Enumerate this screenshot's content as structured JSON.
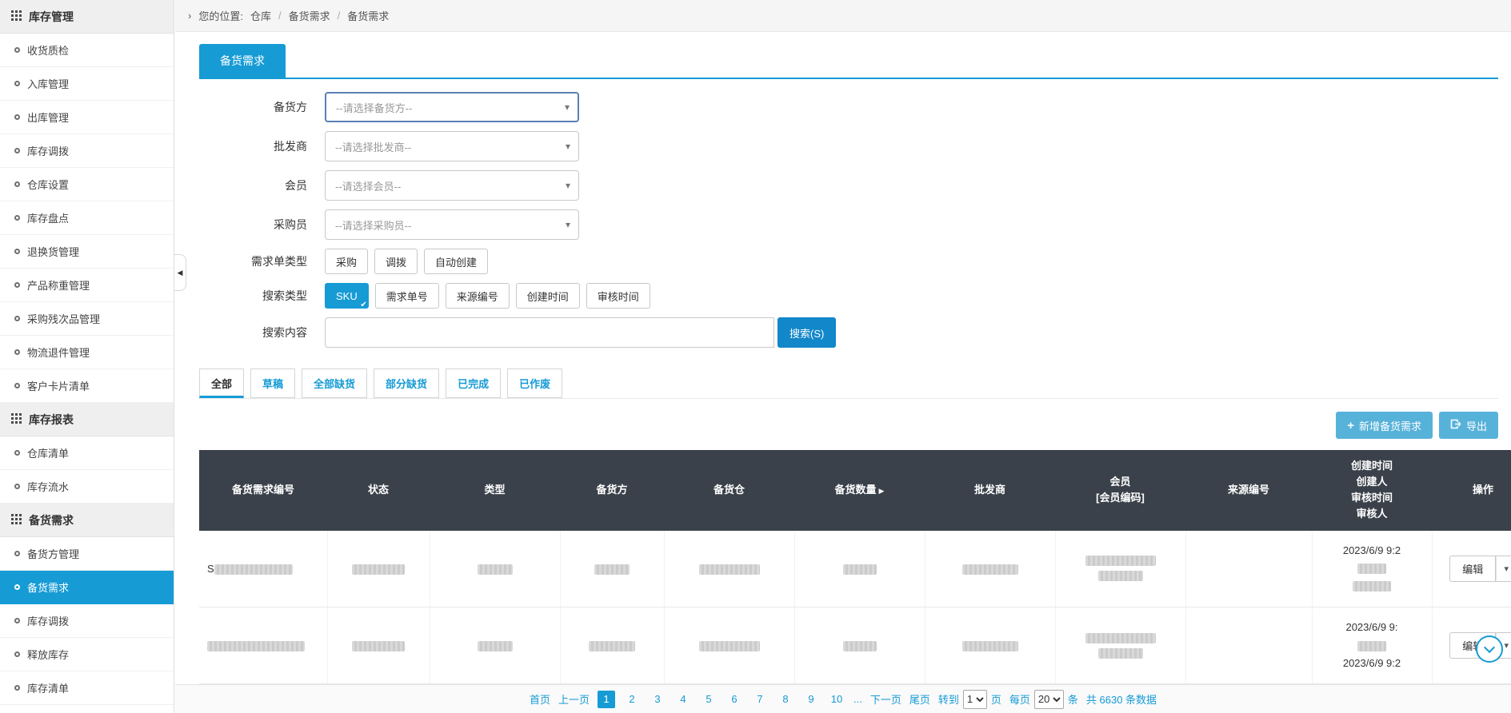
{
  "app": {
    "primary_color": "#169bd5",
    "table_header_color": "#3a414a"
  },
  "icons": {
    "breadcrumb_arrow": "›",
    "caret_down": "▾",
    "check": "✔",
    "sort_right": "▶",
    "collapse_left": "◀",
    "add": "+",
    "ellipsis": "..."
  },
  "sidebar": {
    "sections": [
      {
        "title": "库存管理",
        "items": [
          "收货质检",
          "入库管理",
          "出库管理",
          "库存调拨",
          "仓库设置",
          "库存盘点",
          "退换货管理",
          "产品称重管理",
          "采购残次品管理",
          "物流退件管理",
          "客户卡片清单"
        ]
      },
      {
        "title": "库存报表",
        "items": [
          "仓库清单",
          "库存流水"
        ]
      },
      {
        "title": "备货需求",
        "items": [
          "备货方管理",
          "备货需求",
          "库存调拨",
          "释放库存",
          "库存清单"
        ]
      }
    ],
    "active_item": "备货需求"
  },
  "breadcrumb": {
    "prefix": "您的位置:",
    "separator": "/",
    "items": [
      "仓库",
      "备货需求",
      "备货需求"
    ]
  },
  "page_tab": "备货需求",
  "filters": {
    "supplier": {
      "label": "备货方",
      "placeholder": "--请选择备货方--"
    },
    "wholesaler": {
      "label": "批发商",
      "placeholder": "--请选择批发商--"
    },
    "member": {
      "label": "会员",
      "placeholder": "--请选择会员--"
    },
    "buyer": {
      "label": "采购员",
      "placeholder": "--请选择采购员--"
    },
    "demand_type": {
      "label": "需求单类型",
      "options": [
        "采购",
        "调拨",
        "自动创建"
      ]
    },
    "search_type": {
      "label": "搜索类型",
      "options": [
        "SKU",
        "需求单号",
        "来源编号",
        "创建时间",
        "审核时间"
      ],
      "active": "SKU"
    },
    "search": {
      "label": "搜索内容",
      "value": "",
      "button": "搜索(S)"
    }
  },
  "status_tabs": {
    "items": [
      "全部",
      "草稿",
      "全部缺货",
      "部分缺货",
      "已完成",
      "已作废"
    ],
    "active": "全部"
  },
  "toolbar": {
    "add": "新增备货需求",
    "export": "导出"
  },
  "table": {
    "headers": [
      "备货需求编号",
      "状态",
      "类型",
      "备货方",
      "备货仓",
      "备货数量",
      "批发商",
      "会员\n[会员编码]",
      "来源编号",
      "创建时间\n创建人\n审核时间\n审核人",
      "操作"
    ],
    "rows": [
      {
        "id_visible": "S",
        "created_visible": "2023/6/9 9:2",
        "edit_label": "编辑"
      },
      {
        "id_visible": "",
        "created_visible": "2023/6/9 9:",
        "audited_visible": "2023/6/9 9:2",
        "edit_label": "编辑"
      }
    ]
  },
  "pagination": {
    "first": "首页",
    "prev": "上一页",
    "pages": [
      "1",
      "2",
      "3",
      "4",
      "5",
      "6",
      "7",
      "8",
      "9",
      "10"
    ],
    "active_page": "1",
    "next": "下一页",
    "last": "尾页",
    "goto_label": "转到",
    "goto_value": "1",
    "goto_suffix": "页",
    "per_page_label": "每页",
    "per_page_value": "20",
    "per_page_suffix": "条",
    "total": "共 6630 条数据"
  }
}
